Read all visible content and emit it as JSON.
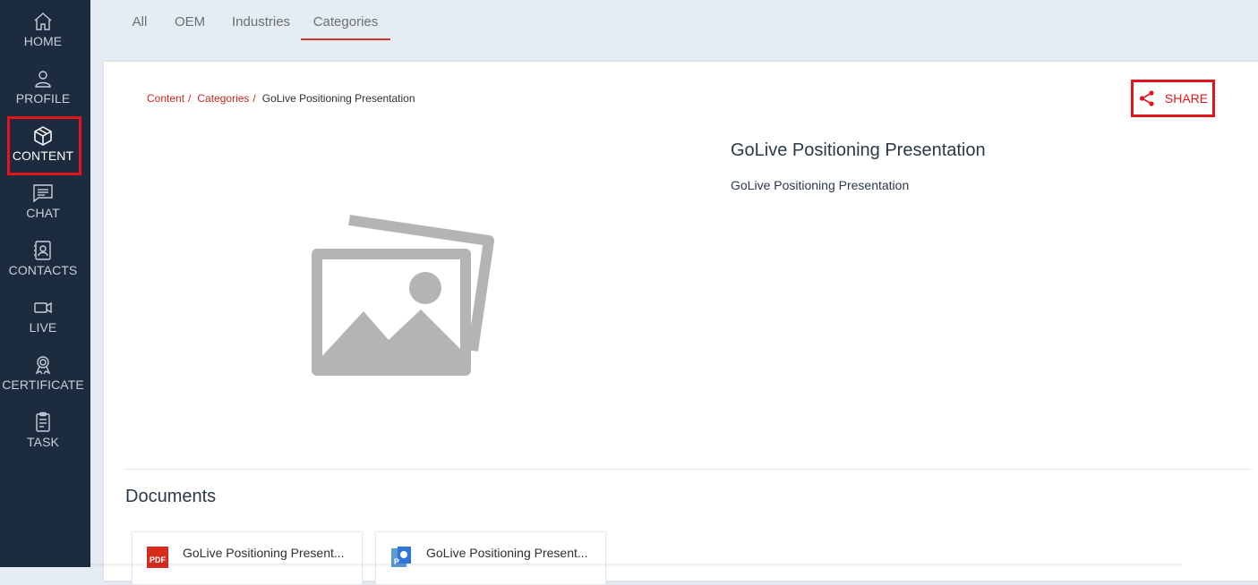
{
  "sidebar": {
    "items": [
      {
        "label": "HOME",
        "icon": "home-icon"
      },
      {
        "label": "PROFILE",
        "icon": "user-icon"
      },
      {
        "label": "CONTENT",
        "icon": "cube-icon"
      },
      {
        "label": "CHAT",
        "icon": "chat-icon"
      },
      {
        "label": "CONTACTS",
        "icon": "contacts-icon"
      },
      {
        "label": "LIVE",
        "icon": "video-icon"
      },
      {
        "label": "CERTIFICATE",
        "icon": "certificate-icon"
      },
      {
        "label": "TASK",
        "icon": "clipboard-icon"
      }
    ],
    "active": "CONTENT"
  },
  "tabs": {
    "items": [
      {
        "label": "All"
      },
      {
        "label": "OEM"
      },
      {
        "label": "Industries"
      },
      {
        "label": "Categories"
      }
    ],
    "active": "Categories"
  },
  "breadcrumb": {
    "items": [
      "Content",
      "Categories"
    ],
    "separator": "/",
    "current": "GoLive Positioning Presentation"
  },
  "share": {
    "label": "SHARE",
    "icon": "share-icon"
  },
  "main": {
    "title": "GoLive Positioning Presentation",
    "description": "GoLive Positioning Presentation",
    "image_icon": "image-placeholder-icon"
  },
  "documents": {
    "heading": "Documents",
    "items": [
      {
        "name": "GoLive Positioning Present...",
        "icon": "pdf-icon",
        "badge": "PDF"
      },
      {
        "name": "GoLive Positioning Present...",
        "icon": "powerpoint-icon",
        "badge": "P"
      }
    ]
  },
  "colors": {
    "sidebar_bg": "#1d2b3f",
    "accent_red": "#e3141b",
    "link_red": "#c8261e",
    "page_bg": "#e6ecf3"
  }
}
